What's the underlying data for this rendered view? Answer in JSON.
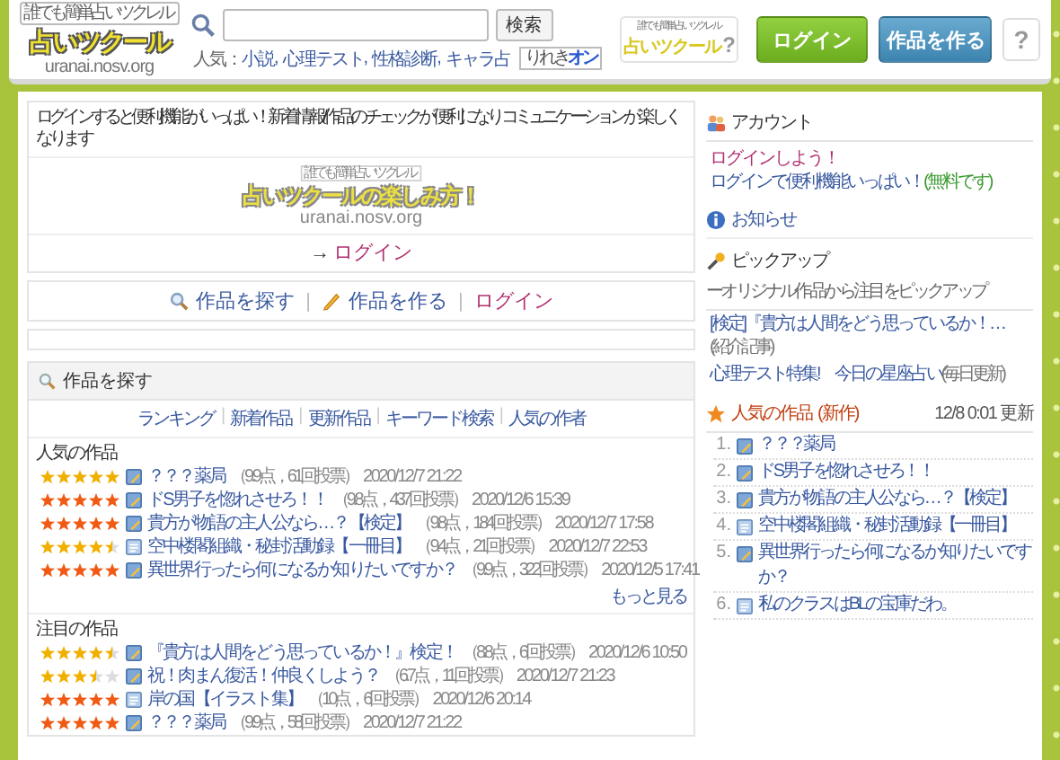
{
  "header": {
    "logo": {
      "tagline": "誰でも簡単占いツクレル",
      "name": "占いツクール",
      "url": "uranai.nosv.org"
    },
    "search": {
      "button": "検索"
    },
    "popular": {
      "label": "人気：",
      "separator": ",",
      "links": [
        "小説",
        "心理テスト",
        "性格診断",
        "キャラ占"
      ]
    },
    "history_toggle": {
      "label": "りれき",
      "state": "オン"
    },
    "guide_button": {
      "tagline": "誰でも簡単占いツクレル",
      "name": "占いツクール",
      "mark": "?"
    },
    "buttons": [
      {
        "label": "ログイン",
        "kind": "login"
      },
      {
        "label": "作品を作る",
        "kind": "create"
      }
    ],
    "help_button": "?"
  },
  "login_panel": {
    "message": "ログインすると便利機能がいっぱい！新着情報/作品のチェックが便利になりコミュニケーションが楽しくなります",
    "banner": {
      "tagline": "誰でも簡単占いツクレル",
      "name": "占いツクールの楽しみ方！",
      "url": "uranai.nosv.org"
    },
    "arrow": "→",
    "link": "ログイン"
  },
  "quick_links": {
    "separator": "|",
    "items": [
      {
        "label": "作品を探す",
        "kind": "search"
      },
      {
        "label": "作品を作る",
        "kind": "pencil"
      },
      {
        "label": "ログイン",
        "kind": "login"
      }
    ]
  },
  "search_section": {
    "title": "作品を探す",
    "nav": {
      "separator": "|",
      "links": [
        "ランキング",
        "新着作品",
        "更新作品",
        "キーワード検索",
        "人気の作者"
      ]
    },
    "groups": [
      {
        "title": "人気の作品",
        "more": "もっと見る",
        "items": [
          {
            "stars": 5,
            "color": "#f0b000",
            "kind": "pencil",
            "title": "？？？薬局",
            "meta": "（9.9点，61回投票）",
            "date": "2020/12/7 21:22"
          },
          {
            "stars": 5,
            "color": "#f05a14",
            "kind": "pencil",
            "title": "ドS男子を惚れさせろ！！",
            "meta": "（9.8点，437回投票）",
            "date": "2020/12/6 15:39"
          },
          {
            "stars": 5,
            "color": "#f05a14",
            "kind": "pencil",
            "title": "貴方が物語の主人公なら…？【検定】",
            "meta": "（9.8点，184回投票）",
            "date": "2020/12/7 17:58"
          },
          {
            "stars": 4.5,
            "color": "#f0b000",
            "kind": "plain",
            "title": "空中楼閣組織・秘封活動録【一冊目】",
            "meta": "（9.4点，21回投票）",
            "date": "2020/12/7 22:53"
          },
          {
            "stars": 5,
            "color": "#f05a14",
            "kind": "pencil",
            "title": "異世界行ったら何になるか知りたいですか？",
            "meta": "（9.9点，322回投票）",
            "date": "2020/12/5 17:41"
          }
        ]
      },
      {
        "title": "注目の作品",
        "items": [
          {
            "stars": 4.5,
            "color": "#f0b000",
            "kind": "pencil",
            "title": "『貴方は人間をどう思っているか！』検定！",
            "meta": "（8.8点，6回投票）",
            "date": "2020/12/6 10:50"
          },
          {
            "stars": 3.5,
            "color": "#f0b000",
            "kind": "pencil",
            "title": "祝！肉まん復活！仲良くしよう？",
            "meta": "（6.7点，11回投票）",
            "date": "2020/12/7 21:23"
          },
          {
            "stars": 5,
            "color": "#f05a14",
            "kind": "plain",
            "title": "岸の国【イラスト集】",
            "meta": "（10点，6回投票）",
            "date": "2020/12/6 20:14"
          },
          {
            "stars": 5,
            "color": "#f05a14",
            "kind": "pencil",
            "title": "？？？薬局",
            "meta": "（9.9点，58回投票）",
            "date": "2020/12/7 21:22"
          }
        ]
      }
    ]
  },
  "sidebar": {
    "account": {
      "title": "アカウント",
      "login": "ログインしよう！",
      "note": "ログインで便利機能いっぱい！",
      "note_free": "(無料です)"
    },
    "news": {
      "title": "お知らせ"
    },
    "pickup": {
      "title": "ピックアップ",
      "description": "ーオリジナル作品から注目をピックアップ",
      "links": [
        {
          "text": "[検定]『貴方は人間をどう思っているか！…",
          "tag": "(紹介記事)"
        },
        {
          "text": "心理テスト特集!　今日の星座占い",
          "tag": "(毎日更新)"
        }
      ]
    },
    "ranking": {
      "title": "人気の作品",
      "tag": "(新作)",
      "updated": "12/8 0:01 更新",
      "items": [
        {
          "rank": "1.",
          "kind": "pencil",
          "title": "？？？薬局"
        },
        {
          "rank": "2.",
          "kind": "pencil",
          "title": "ドS男子を惚れさせろ！！"
        },
        {
          "rank": "3.",
          "kind": "pencil",
          "title": "貴方が物語の主人公なら…？【検定】"
        },
        {
          "rank": "4.",
          "kind": "plain",
          "title": "空中楼閣組織・秘封活動録【一冊目】"
        },
        {
          "rank": "5.",
          "kind": "pencil",
          "title": "異世界行ったら何になるか知りたいですか？"
        },
        {
          "rank": "6.",
          "kind": "plain",
          "title": "私のクラスはBLの宝庫だわ。"
        }
      ]
    }
  }
}
